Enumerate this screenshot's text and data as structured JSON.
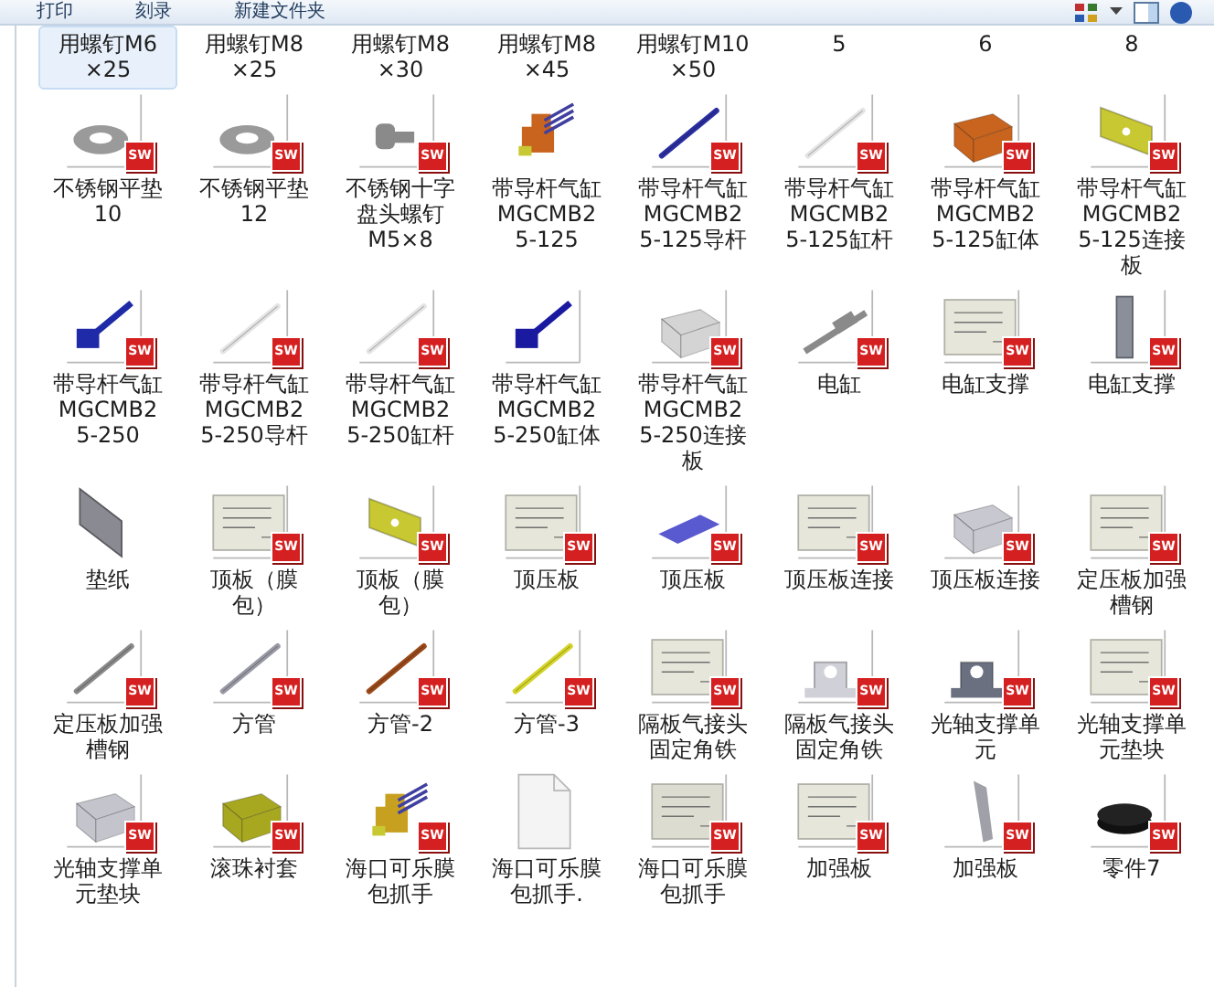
{
  "toolbar": {
    "items": [
      "打印",
      "刻录",
      "新建文件夹"
    ]
  },
  "files": [
    {
      "lines": [
        "用螺钉M6",
        "×25"
      ],
      "selected": true
    },
    {
      "lines": [
        "用螺钉M8",
        "×25"
      ],
      "selected": false
    },
    {
      "lines": [
        "用螺钉M8",
        "×30"
      ],
      "selected": false
    },
    {
      "lines": [
        "用螺钉M8",
        "×45"
      ],
      "selected": false
    },
    {
      "lines": [
        "用螺钉M10",
        "×50"
      ],
      "selected": false
    },
    {
      "lines": [
        "5"
      ],
      "selected": false
    },
    {
      "lines": [
        "6"
      ],
      "selected": false
    },
    {
      "lines": [
        "8"
      ],
      "selected": false
    },
    {
      "lines": [
        "不锈钢平垫",
        "10"
      ],
      "selected": false,
      "kind": "washer",
      "color": "#9a9a9a",
      "badge": "SW"
    },
    {
      "lines": [
        "不锈钢平垫",
        "12"
      ],
      "selected": false,
      "kind": "washer",
      "color": "#9a9a9a",
      "badge": "SW"
    },
    {
      "lines": [
        "不锈钢十字",
        "盘头螺钉",
        "M5×8"
      ],
      "selected": false,
      "kind": "screw",
      "color": "#8a8a8a",
      "badge": "SW"
    },
    {
      "lines": [
        "带导杆气缸",
        "MGCMB2",
        "5-125"
      ],
      "selected": false,
      "kind": "assembly",
      "color": "#c8641e"
    },
    {
      "lines": [
        "带导杆气缸",
        "MGCMB2",
        "5-125导杆"
      ],
      "selected": false,
      "kind": "rod",
      "color": "#2b2fa0",
      "badge": "SW"
    },
    {
      "lines": [
        "带导杆气缸",
        "MGCMB2",
        "5-125缸杆"
      ],
      "selected": false,
      "kind": "rod",
      "color": "#e4e4e4",
      "badge": "SW"
    },
    {
      "lines": [
        "带导杆气缸",
        "MGCMB2",
        "5-125缸体"
      ],
      "selected": false,
      "kind": "block",
      "color": "#c8641e",
      "badge": "SW"
    },
    {
      "lines": [
        "带导杆气缸",
        "MGCMB2",
        "5-125连接",
        "板"
      ],
      "selected": false,
      "kind": "plate",
      "color": "#c8c832",
      "badge": "SW"
    },
    {
      "lines": [
        "带导杆气缸",
        "MGCMB2",
        "5-250"
      ],
      "selected": false,
      "kind": "cylinder",
      "color": "#1f2aa8",
      "badge": "SW"
    },
    {
      "lines": [
        "带导杆气缸",
        "MGCMB2",
        "5-250导杆"
      ],
      "selected": false,
      "kind": "rod",
      "color": "#e4e4e4",
      "badge": "SW"
    },
    {
      "lines": [
        "带导杆气缸",
        "MGCMB2",
        "5-250缸杆"
      ],
      "selected": false,
      "kind": "rod",
      "color": "#e4e4e4",
      "badge": "SW"
    },
    {
      "lines": [
        "带导杆气缸",
        "MGCMB2",
        "5-250缸体"
      ],
      "selected": false,
      "kind": "cylinder",
      "color": "#1a1aa0"
    },
    {
      "lines": [
        "带导杆气缸",
        "MGCMB2",
        "5-250连接",
        "板"
      ],
      "selected": false,
      "kind": "block",
      "color": "#d4d4d4",
      "badge": "SW"
    },
    {
      "lines": [
        "电缸"
      ],
      "selected": false,
      "kind": "actuator",
      "color": "#8a8a8a",
      "badge": "SW"
    },
    {
      "lines": [
        "电缸支撑"
      ],
      "selected": false,
      "kind": "drawing",
      "color": "#e6e6da",
      "badge": "SW"
    },
    {
      "lines": [
        "电缸支撑"
      ],
      "selected": false,
      "kind": "post",
      "color": "#8a8f9a",
      "badge": "SW"
    },
    {
      "lines": [
        "垫纸"
      ],
      "selected": false,
      "kind": "sheet",
      "color": "#8a8a92"
    },
    {
      "lines": [
        "顶板（膜",
        "包）"
      ],
      "selected": false,
      "kind": "drawing",
      "color": "#e6e6da",
      "badge": "SW"
    },
    {
      "lines": [
        "顶板（膜",
        "包）"
      ],
      "selected": false,
      "kind": "plate",
      "color": "#c8c832",
      "badge": "SW"
    },
    {
      "lines": [
        "顶压板"
      ],
      "selected": false,
      "kind": "drawing",
      "color": "#e6e6da",
      "badge": "SW"
    },
    {
      "lines": [
        "顶压板"
      ],
      "selected": false,
      "kind": "flat",
      "color": "#5a5ad0",
      "badge": "SW"
    },
    {
      "lines": [
        "顶压板连接"
      ],
      "selected": false,
      "kind": "drawing",
      "color": "#e6e6da",
      "badge": "SW"
    },
    {
      "lines": [
        "顶压板连接"
      ],
      "selected": false,
      "kind": "block",
      "color": "#c8c8d0",
      "badge": "SW"
    },
    {
      "lines": [
        "定压板加强",
        "槽钢"
      ],
      "selected": false,
      "kind": "drawing",
      "color": "#e6e6da",
      "badge": "SW"
    },
    {
      "lines": [
        "定压板加强",
        "槽钢"
      ],
      "selected": false,
      "kind": "rod",
      "color": "#8a8a8a",
      "badge": "SW"
    },
    {
      "lines": [
        "方管"
      ],
      "selected": false,
      "kind": "rod",
      "color": "#9a9aa6",
      "badge": "SW"
    },
    {
      "lines": [
        "方管-2"
      ],
      "selected": false,
      "kind": "rod",
      "color": "#9a4a1a",
      "badge": "SW"
    },
    {
      "lines": [
        "方管-3"
      ],
      "selected": false,
      "kind": "rod",
      "color": "#d4d42a",
      "badge": "SW"
    },
    {
      "lines": [
        "隔板气接头",
        "固定角铁"
      ],
      "selected": false,
      "kind": "drawing",
      "color": "#e6e6da",
      "badge": "SW"
    },
    {
      "lines": [
        "隔板气接头",
        "固定角铁"
      ],
      "selected": false,
      "kind": "bracket",
      "color": "#d0d0d8",
      "badge": "SW"
    },
    {
      "lines": [
        "光轴支撑单",
        "元"
      ],
      "selected": false,
      "kind": "bracket",
      "color": "#6a7080",
      "badge": "SW"
    },
    {
      "lines": [
        "光轴支撑单",
        "元垫块"
      ],
      "selected": false,
      "kind": "drawing",
      "color": "#e6e6da",
      "badge": "SW"
    },
    {
      "lines": [
        "光轴支撑单",
        "元垫块"
      ],
      "selected": false,
      "kind": "block",
      "color": "#c4c4cc",
      "badge": "SW"
    },
    {
      "lines": [
        "滚珠衬套"
      ],
      "selected": false,
      "kind": "block",
      "color": "#a8a820",
      "badge": "SW"
    },
    {
      "lines": [
        "海口可乐膜",
        "包抓手"
      ],
      "selected": false,
      "kind": "assembly",
      "color": "#c8a020",
      "badge": "SW"
    },
    {
      "lines": [
        "海口可乐膜",
        "包抓手."
      ],
      "selected": false,
      "kind": "doc",
      "color": "#f4f4f4"
    },
    {
      "lines": [
        "海口可乐膜",
        "包抓手"
      ],
      "selected": false,
      "kind": "drawing",
      "color": "#dcdcd0",
      "badge": "SW"
    },
    {
      "lines": [
        "加强板"
      ],
      "selected": false,
      "kind": "drawing",
      "color": "#e6e6da",
      "badge": "SW"
    },
    {
      "lines": [
        "加强板"
      ],
      "selected": false,
      "kind": "fin",
      "color": "#a0a0a8",
      "badge": "SW"
    },
    {
      "lines": [
        "零件7"
      ],
      "selected": false,
      "kind": "disc",
      "color": "#222222",
      "badge": "SW"
    }
  ]
}
